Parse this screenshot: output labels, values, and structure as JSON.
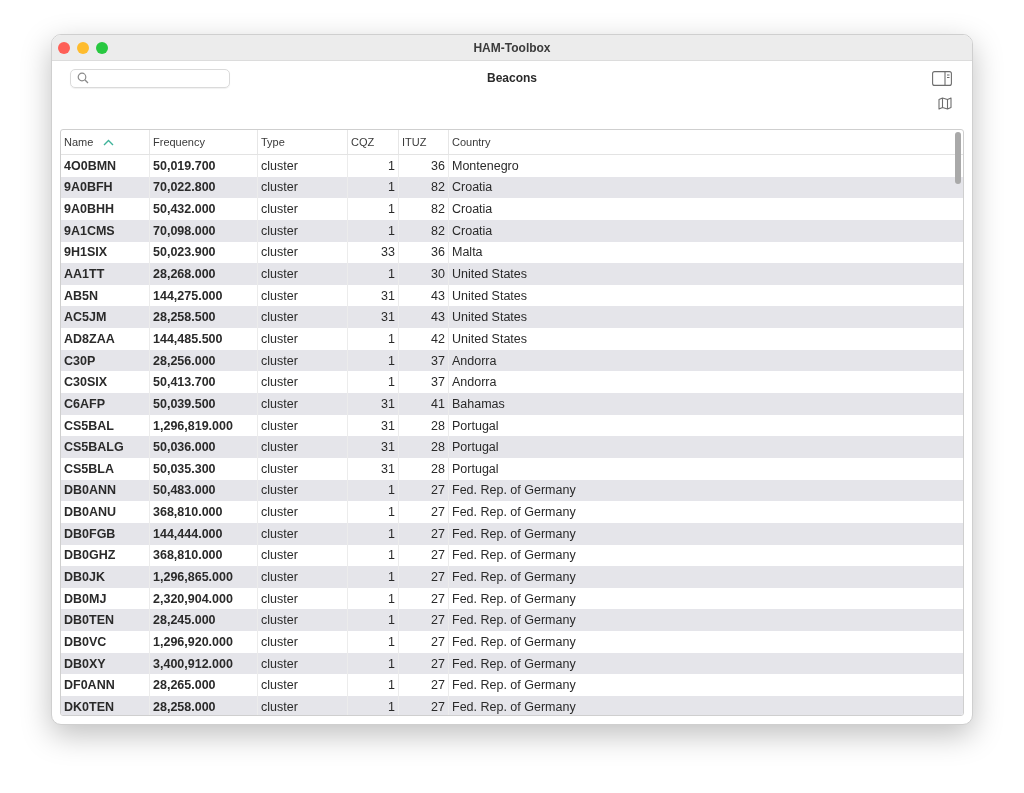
{
  "window": {
    "title": "HAM-Toolbox"
  },
  "view_title": "Beacons",
  "table": {
    "columns": [
      {
        "label": "Name",
        "sorted": true
      },
      {
        "label": "Frequency",
        "sorted": false
      },
      {
        "label": "Type",
        "sorted": false
      },
      {
        "label": "CQZ",
        "sorted": false
      },
      {
        "label": "ITUZ",
        "sorted": false
      },
      {
        "label": "Country",
        "sorted": false
      }
    ],
    "rows": [
      [
        "4O0BMN",
        "50,019.700",
        "cluster",
        "1",
        "36",
        "Montenegro"
      ],
      [
        "9A0BFH",
        "70,022.800",
        "cluster",
        "1",
        "82",
        "Croatia"
      ],
      [
        "9A0BHH",
        "50,432.000",
        "cluster",
        "1",
        "82",
        "Croatia"
      ],
      [
        "9A1CMS",
        "70,098.000",
        "cluster",
        "1",
        "82",
        "Croatia"
      ],
      [
        "9H1SIX",
        "50,023.900",
        "cluster",
        "33",
        "36",
        "Malta"
      ],
      [
        "AA1TT",
        "28,268.000",
        "cluster",
        "1",
        "30",
        "United States"
      ],
      [
        "AB5N",
        "144,275.000",
        "cluster",
        "31",
        "43",
        "United States"
      ],
      [
        "AC5JM",
        "28,258.500",
        "cluster",
        "31",
        "43",
        "United States"
      ],
      [
        "AD8ZAA",
        "144,485.500",
        "cluster",
        "1",
        "42",
        "United States"
      ],
      [
        "C30P",
        "28,256.000",
        "cluster",
        "1",
        "37",
        "Andorra"
      ],
      [
        "C30SIX",
        "50,413.700",
        "cluster",
        "1",
        "37",
        "Andorra"
      ],
      [
        "C6AFP",
        "50,039.500",
        "cluster",
        "31",
        "41",
        "Bahamas"
      ],
      [
        "CS5BAL",
        "1,296,819.000",
        "cluster",
        "31",
        "28",
        "Portugal"
      ],
      [
        "CS5BALG",
        "50,036.000",
        "cluster",
        "31",
        "28",
        "Portugal"
      ],
      [
        "CS5BLA",
        "50,035.300",
        "cluster",
        "31",
        "28",
        "Portugal"
      ],
      [
        "DB0ANN",
        "50,483.000",
        "cluster",
        "1",
        "27",
        "Fed. Rep. of Germany"
      ],
      [
        "DB0ANU",
        "368,810.000",
        "cluster",
        "1",
        "27",
        "Fed. Rep. of Germany"
      ],
      [
        "DB0FGB",
        "144,444.000",
        "cluster",
        "1",
        "27",
        "Fed. Rep. of Germany"
      ],
      [
        "DB0GHZ",
        "368,810.000",
        "cluster",
        "1",
        "27",
        "Fed. Rep. of Germany"
      ],
      [
        "DB0JK",
        "1,296,865.000",
        "cluster",
        "1",
        "27",
        "Fed. Rep. of Germany"
      ],
      [
        "DB0MJ",
        "2,320,904.000",
        "cluster",
        "1",
        "27",
        "Fed. Rep. of Germany"
      ],
      [
        "DB0TEN",
        "28,245.000",
        "cluster",
        "1",
        "27",
        "Fed. Rep. of Germany"
      ],
      [
        "DB0VC",
        "1,296,920.000",
        "cluster",
        "1",
        "27",
        "Fed. Rep. of Germany"
      ],
      [
        "DB0XY",
        "3,400,912.000",
        "cluster",
        "1",
        "27",
        "Fed. Rep. of Germany"
      ],
      [
        "DF0ANN",
        "28,265.000",
        "cluster",
        "1",
        "27",
        "Fed. Rep. of Germany"
      ],
      [
        "DK0TEN",
        "28,258.000",
        "cluster",
        "1",
        "27",
        "Fed. Rep. of Germany"
      ]
    ]
  }
}
